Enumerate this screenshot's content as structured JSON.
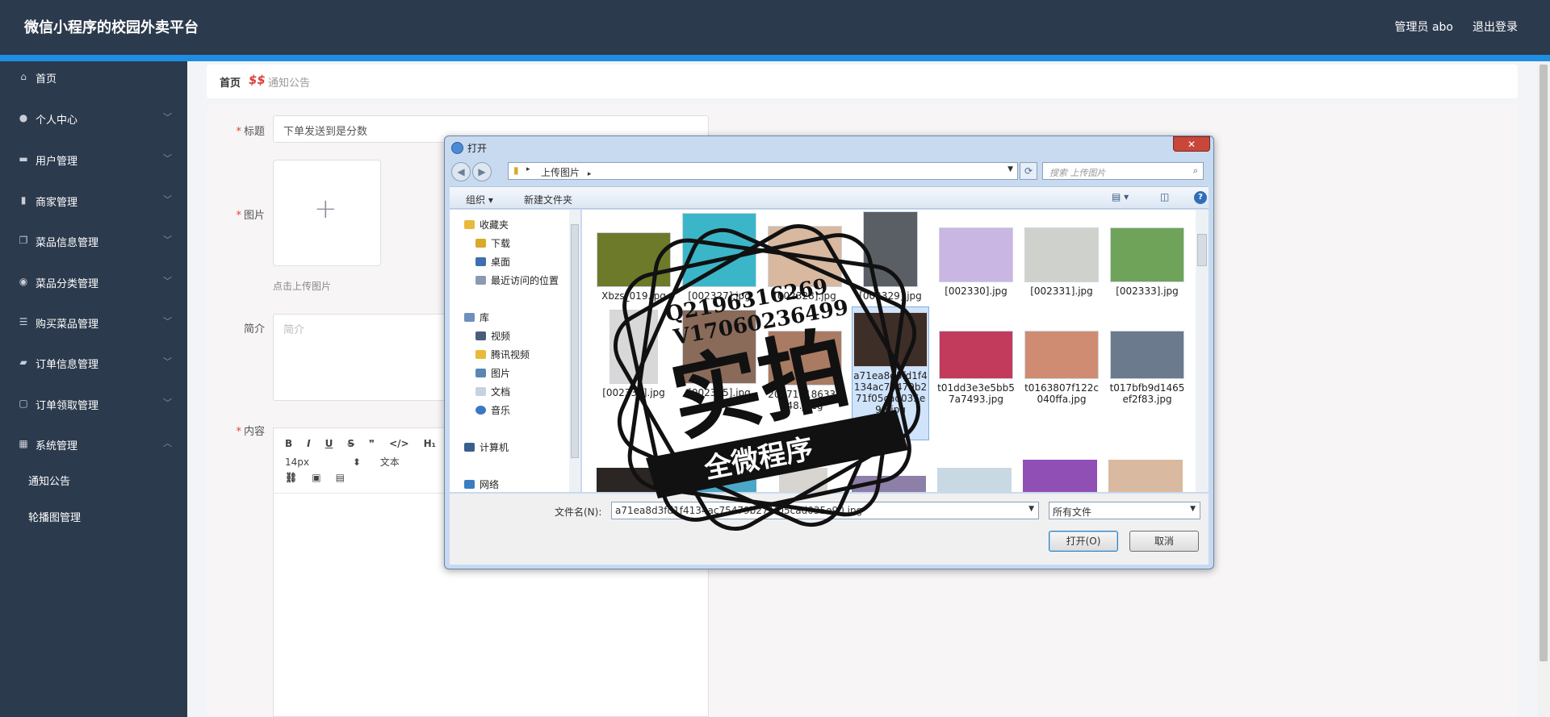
{
  "header": {
    "title": "微信小程序的校园外卖平台",
    "user": "管理员 abo",
    "logout": "退出登录"
  },
  "sidebar": {
    "items": [
      {
        "label": "首页",
        "icon": "home-icon"
      },
      {
        "label": "个人中心",
        "icon": "user-icon"
      },
      {
        "label": "用户管理",
        "icon": "briefcase-icon"
      },
      {
        "label": "商家管理",
        "icon": "bar-chart-icon"
      },
      {
        "label": "菜品信息管理",
        "icon": "copy-icon"
      },
      {
        "label": "菜品分类管理",
        "icon": "location-icon"
      },
      {
        "label": "购买菜品管理",
        "icon": "list-icon"
      },
      {
        "label": "订单信息管理",
        "icon": "ticket-icon"
      },
      {
        "label": "订单领取管理",
        "icon": "message-icon"
      },
      {
        "label": "系统管理",
        "icon": "grid-icon"
      }
    ],
    "sub_items": [
      "通知公告",
      "轮播图管理"
    ]
  },
  "breadcrumb": {
    "home": "首页",
    "current": "通知公告"
  },
  "form": {
    "title_label": "标题",
    "title_value": "下单发送到是分数",
    "image_label": "图片",
    "upload_hint": "点击上传图片",
    "intro_label": "简介",
    "intro_placeholder": "简介",
    "content_label": "内容",
    "editor": {
      "font_size": "14px",
      "format": "文本"
    }
  },
  "dialog": {
    "title": "打开",
    "close": "✕",
    "path": "上传图片",
    "search_placeholder": "搜索 上传图片",
    "organize": "组织 ▾",
    "new_folder": "新建文件夹",
    "nav": {
      "favorites": "收藏夹",
      "downloads": "下载",
      "desktop": "桌面",
      "recent": "最近访问的位置",
      "library": "库",
      "videos": "视频",
      "tencent_video": "腾讯视频",
      "pictures": "图片",
      "documents": "文档",
      "music": "音乐",
      "computer": "计算机",
      "network": "网络"
    },
    "files": [
      {
        "name": "Xbzs_019.jpg",
        "color": "#6d7a2a"
      },
      {
        "name": "[002327].jpg",
        "color": "#3bb6c9"
      },
      {
        "name": "[002328].jpg",
        "color": "#d9b8a0"
      },
      {
        "name": "[002329].jpg",
        "color": "#5a5f66"
      },
      {
        "name": "[002330].jpg",
        "color": "#c9b6e3"
      },
      {
        "name": "[002331].jpg",
        "color": "#cfd2cc"
      },
      {
        "name": "[002333].jpg",
        "color": "#6fa35a"
      },
      {
        "name": "[002334].jpg",
        "color": "#d8d8d8"
      },
      {
        "name": "[002335].jpg",
        "color": "#8a6b5a"
      },
      {
        "name": "20171018633548.jpeg",
        "color": "#a97b63"
      },
      {
        "name": "a71ea8d3fd1f4134ac75479b271f05cad035e90.jpg",
        "color": "#3e2e28"
      },
      {
        "name": "t01dd3e3e5bb57a7493.jpg",
        "color": "#c23a5c"
      },
      {
        "name": "t0163807f122c040ffa.jpg",
        "color": "#d08c72"
      },
      {
        "name": "t017bfb9d1465ef2f83.jpg",
        "color": "#6b7a8c"
      }
    ],
    "filename_label": "文件名(N):",
    "filename_value": "a71ea8d3fd1f4134ac75479b271f05cad035e90.jpg",
    "filetype": "所有文件",
    "open": "打开(O)",
    "cancel": "取消"
  },
  "watermark": {
    "qq": "Q2196316269",
    "wx": "V17060236499",
    "main": "实拍",
    "sub": "全微程序"
  }
}
